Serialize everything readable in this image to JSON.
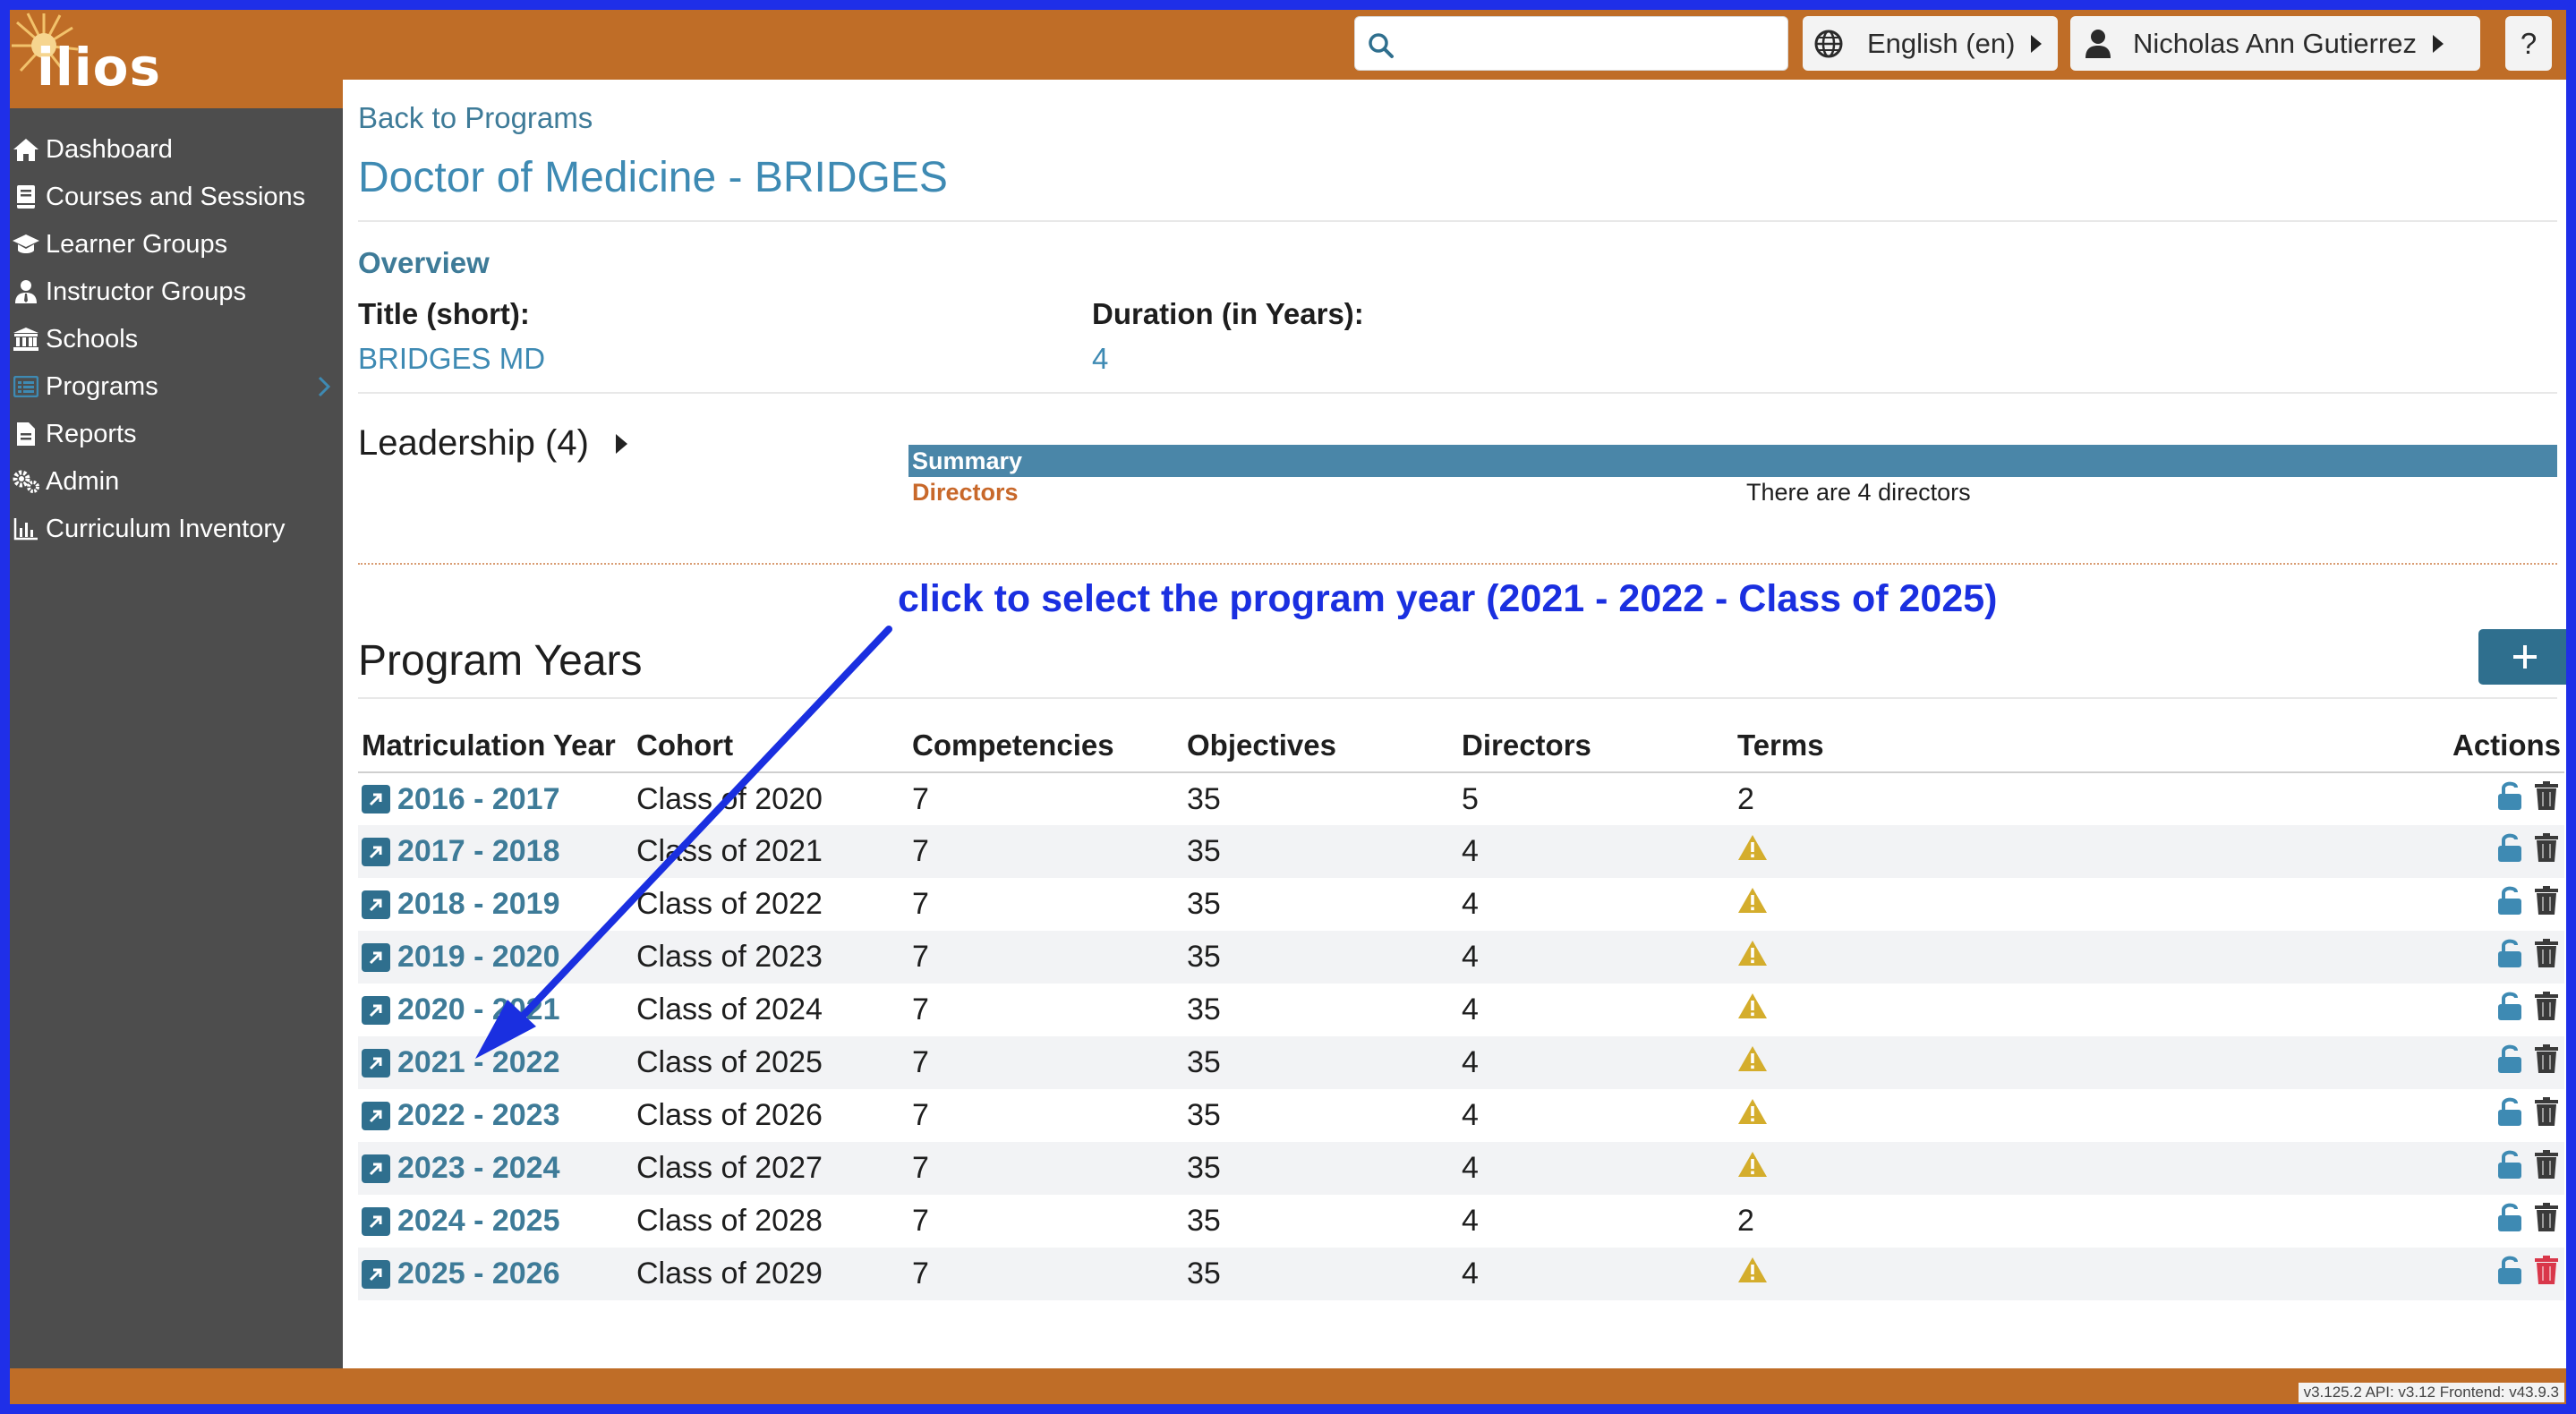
{
  "header": {
    "logo": "ilios",
    "search": {
      "value": "",
      "placeholder": ""
    },
    "language": "English (en)",
    "user": "Nicholas Ann Gutierrez",
    "help": "?"
  },
  "sidebar": {
    "items": [
      {
        "label": "Dashboard",
        "icon": "home-icon"
      },
      {
        "label": "Courses and Sessions",
        "icon": "book-icon"
      },
      {
        "label": "Learner Groups",
        "icon": "graduation-cap-icon"
      },
      {
        "label": "Instructor Groups",
        "icon": "user-tie-icon"
      },
      {
        "label": "Schools",
        "icon": "university-icon"
      },
      {
        "label": "Programs",
        "icon": "list-icon",
        "active": true
      },
      {
        "label": "Reports",
        "icon": "file-icon"
      },
      {
        "label": "Admin",
        "icon": "cogs-icon"
      },
      {
        "label": "Curriculum Inventory",
        "icon": "chart-icon"
      }
    ]
  },
  "main": {
    "back_link": "Back to Programs",
    "title": "Doctor of Medicine - BRIDGES",
    "overview": {
      "heading": "Overview",
      "short_title_label": "Title (short):",
      "short_title_value": "BRIDGES MD",
      "duration_label": "Duration (in Years):",
      "duration_value": "4"
    },
    "leadership": {
      "label": "Leadership (4)",
      "summary_header": "Summary",
      "directors_label": "Directors",
      "directors_text": "There are 4 directors"
    },
    "annotation": "click to select the program year (2021 - 2022 - Class of 2025)",
    "program_years": {
      "title": "Program Years",
      "add_button": "+",
      "columns": [
        "Matriculation Year",
        "Cohort",
        "Competencies",
        "Objectives",
        "Directors",
        "Terms",
        "Actions"
      ],
      "rows": [
        {
          "year": "2016 - 2017",
          "cohort": "Class of 2020",
          "competencies": "7",
          "objectives": "35",
          "directors": "5",
          "terms": "2"
        },
        {
          "year": "2017 - 2018",
          "cohort": "Class of 2021",
          "competencies": "7",
          "objectives": "35",
          "directors": "4",
          "terms": ""
        },
        {
          "year": "2018 - 2019",
          "cohort": "Class of 2022",
          "competencies": "7",
          "objectives": "35",
          "directors": "4",
          "terms": ""
        },
        {
          "year": "2019 - 2020",
          "cohort": "Class of 2023",
          "competencies": "7",
          "objectives": "35",
          "directors": "4",
          "terms": ""
        },
        {
          "year": "2020 - 2021",
          "cohort": "Class of 2024",
          "competencies": "7",
          "objectives": "35",
          "directors": "4",
          "terms": ""
        },
        {
          "year": "2021 - 2022",
          "cohort": "Class of 2025",
          "competencies": "7",
          "objectives": "35",
          "directors": "4",
          "terms": ""
        },
        {
          "year": "2022 - 2023",
          "cohort": "Class of 2026",
          "competencies": "7",
          "objectives": "35",
          "directors": "4",
          "terms": ""
        },
        {
          "year": "2023 - 2024",
          "cohort": "Class of 2027",
          "competencies": "7",
          "objectives": "35",
          "directors": "4",
          "terms": ""
        },
        {
          "year": "2024 - 2025",
          "cohort": "Class of 2028",
          "competencies": "7",
          "objectives": "35",
          "directors": "4",
          "terms": "2"
        },
        {
          "year": "2025 - 2026",
          "cohort": "Class of 2029",
          "competencies": "7",
          "objectives": "35",
          "directors": "4",
          "terms": ""
        }
      ]
    }
  },
  "footer": {
    "version": "v3.125.2 API: v3.12 Frontend: v43.9.3"
  },
  "colors": {
    "header_bg": "#bf6d27",
    "sidebar_bg": "#4d4d4d",
    "link": "#3e7b98",
    "annotation": "#1a2fe0",
    "warning": "#d4ad2c",
    "delete_active": "#d9374a"
  }
}
